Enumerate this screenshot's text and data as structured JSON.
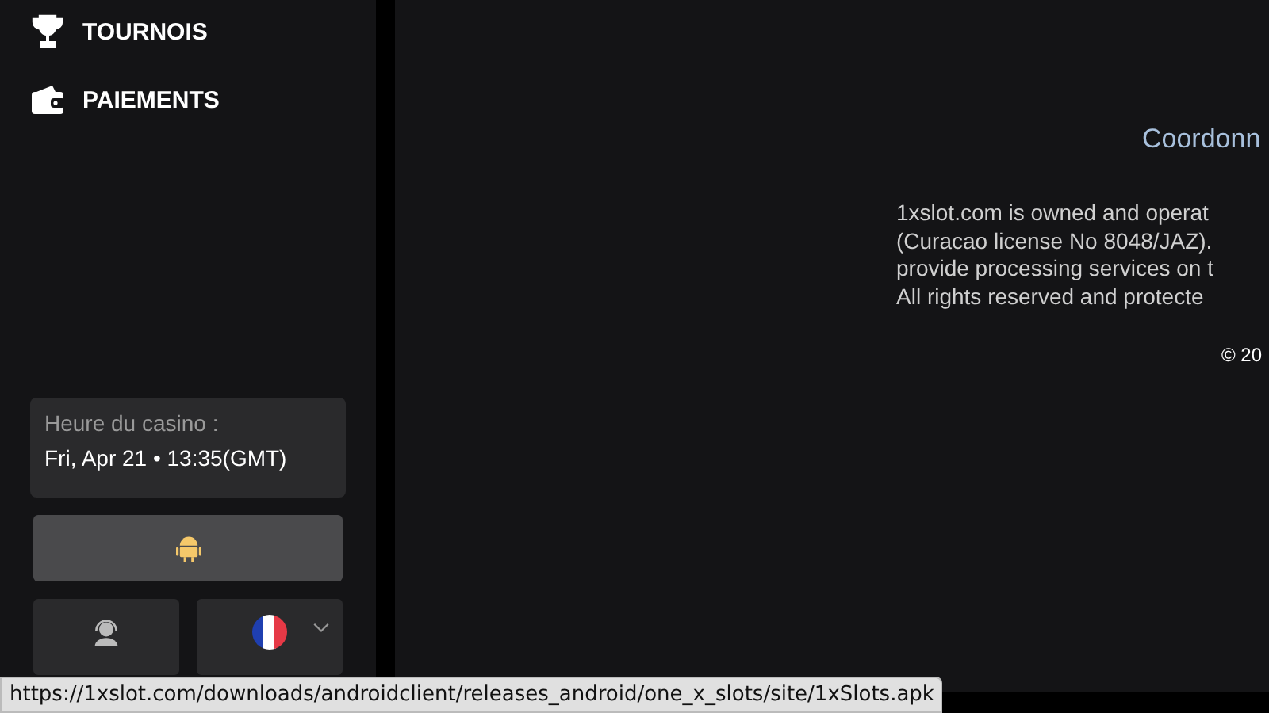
{
  "sidebar": {
    "nav_items": [
      {
        "kind": "trophy",
        "label": "TOURNOIS"
      },
      {
        "kind": "wallet",
        "label": "PAIEMENTS"
      }
    ],
    "casino_time": {
      "label": "Heure du casino :",
      "value": "Fri, Apr 21 • 13:35(GMT)"
    }
  },
  "footer": {
    "heading": "Coordonn",
    "legal_lines": [
      "1xslot.com is owned and operat",
      "(Curacao license No 8048/JAZ).",
      "provide processing services on t",
      "All rights reserved and protecte"
    ],
    "copyright": "© 20"
  },
  "status_bar": {
    "url": "https://1xslot.com/downloads/androidclient/releases_android/one_x_slots/site/1xSlots.apk"
  }
}
